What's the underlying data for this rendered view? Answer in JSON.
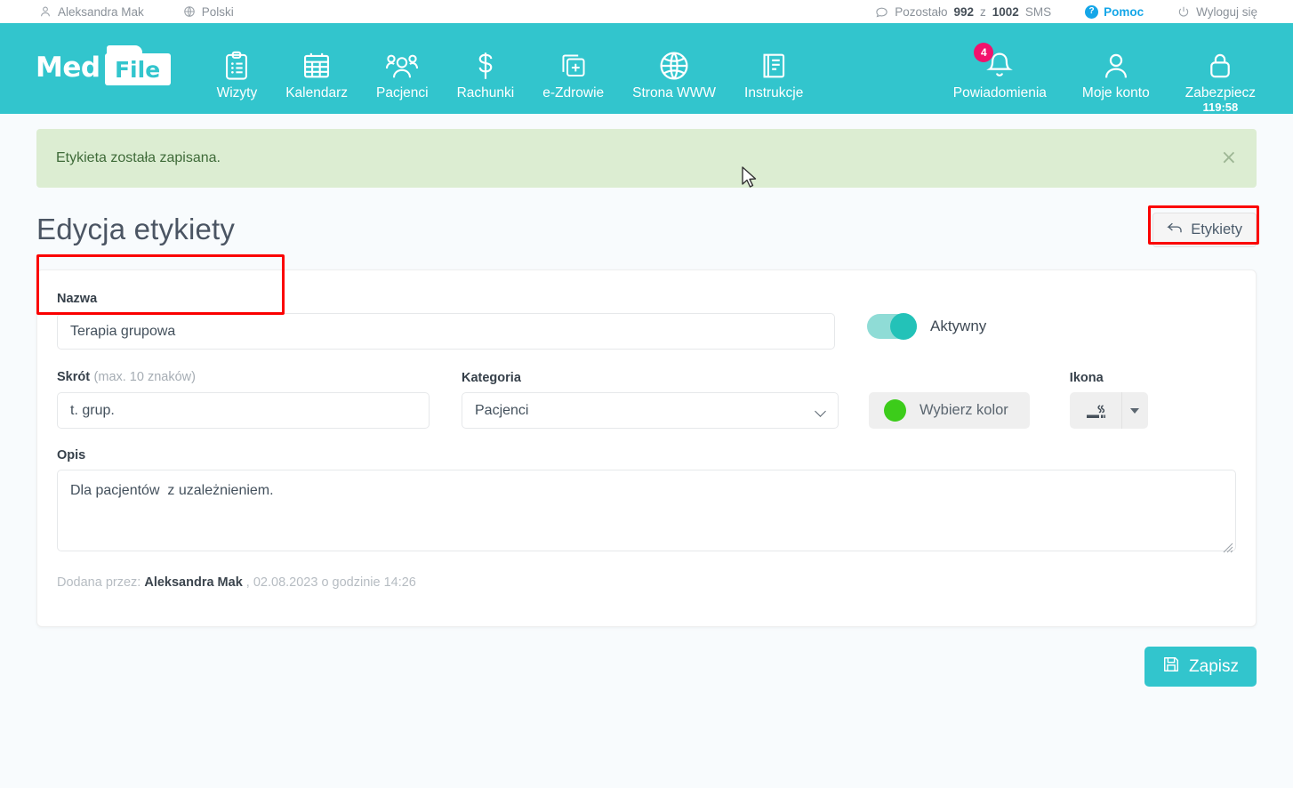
{
  "topbar": {
    "user": "Aleksandra Mak",
    "language": "Polski",
    "sms": "Pozostało 992 z 1002 SMS",
    "sms_prefix": "Pozostało",
    "sms_used": "992",
    "sms_mid": "z",
    "sms_total": "1002",
    "sms_suffix": "SMS",
    "help": "Pomoc",
    "help_badge": "?",
    "logout": "Wyloguj się"
  },
  "brand": {
    "part1": "Med",
    "part2": "File"
  },
  "nav": {
    "items": [
      {
        "label": "Wizyty",
        "icon": "clipboard-icon"
      },
      {
        "label": "Kalendarz",
        "icon": "calendar-icon"
      },
      {
        "label": "Pacjenci",
        "icon": "people-icon"
      },
      {
        "label": "Rachunki",
        "icon": "dollar-icon"
      },
      {
        "label": "e-Zdrowie",
        "icon": "medical-card-icon"
      },
      {
        "label": "Strona WWW",
        "icon": "globe-icon"
      },
      {
        "label": "Instrukcje",
        "icon": "book-icon"
      }
    ],
    "right": [
      {
        "label": "Powiadomienia",
        "icon": "bell-icon",
        "badge": "4"
      },
      {
        "label": "Moje konto",
        "icon": "user-icon"
      },
      {
        "label": "Zabezpiecz",
        "icon": "lock-icon",
        "timer": "119:58"
      }
    ]
  },
  "alert": {
    "message": "Etykieta została zapisana.",
    "close": "×",
    "bg_color": "#dcedd2",
    "text_color": "#3f6b39"
  },
  "page": {
    "title": "Edycja etykiety",
    "back_button": "Etykiety"
  },
  "form": {
    "name_label": "Nazwa",
    "name_value": "Terapia grupowa",
    "active_label": "Aktywny",
    "active_on": true,
    "short_label": "Skrót",
    "short_hint": "(max. 10 znaków)",
    "short_value": "t. grup.",
    "category_label": "Kategoria",
    "category_value": "Pacjenci",
    "category_options": [
      "Pacjenci"
    ],
    "color_button": "Wybierz kolor",
    "color_value": "#3ccc1a",
    "icon_label": "Ikona",
    "icon_value": "smoking-icon",
    "description_label": "Opis",
    "description_value": "Dla pacjentów  z uzależnieniem.",
    "meta_prefix": "Dodana przez:",
    "meta_author": "Aleksandra Mak",
    "meta_suffix": ", 02.08.2023 o godzinie 14:26"
  },
  "actions": {
    "save": "Zapisz"
  },
  "theme": {
    "teal": "#32c5cd",
    "accent_pink": "#f2126c",
    "help_blue": "#14a6e8",
    "annotation_red": "#fb0000"
  }
}
